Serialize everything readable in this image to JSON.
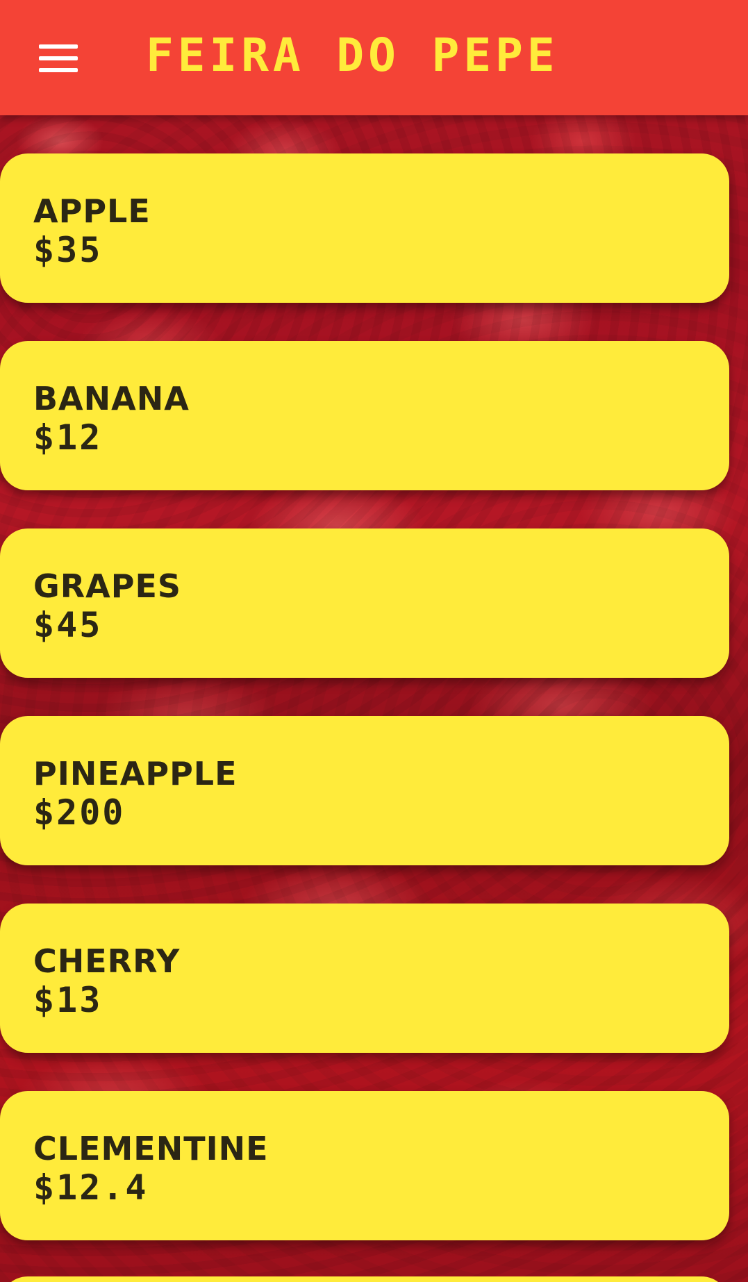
{
  "header": {
    "title": "FEIRA DO PEPE",
    "menu_icon": "hamburger-menu-icon"
  },
  "colors": {
    "header_bg": "#f44336",
    "title": "#ffeb3b",
    "card_bg": "#ffeb3b",
    "card_text": "#2b2614"
  },
  "products": [
    {
      "name": "APPLE",
      "price": "$35"
    },
    {
      "name": "BANANA",
      "price": "$12"
    },
    {
      "name": "GRAPES",
      "price": "$45"
    },
    {
      "name": "PINEAPPLE",
      "price": "$200"
    },
    {
      "name": "CHERRY",
      "price": "$13"
    },
    {
      "name": "CLEMENTINE",
      "price": "$12.4"
    }
  ]
}
